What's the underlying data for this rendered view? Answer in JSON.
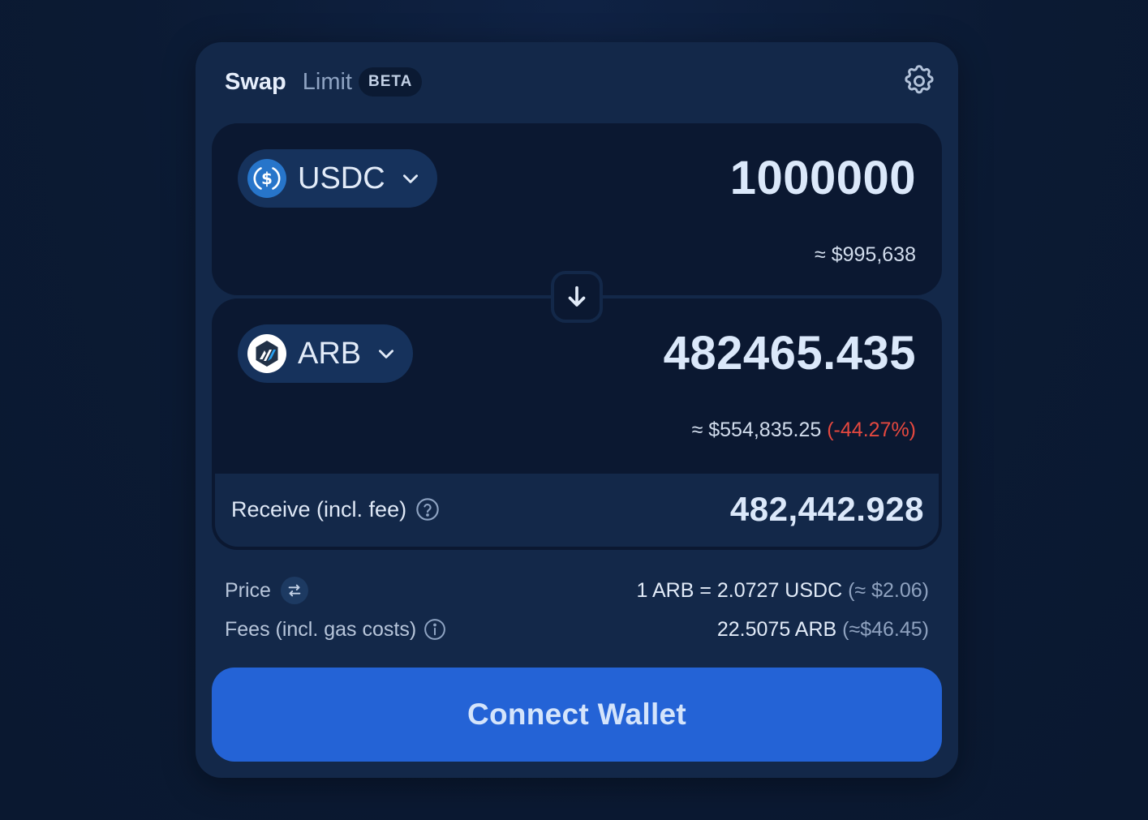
{
  "tabs": {
    "swap": "Swap",
    "limit": "Limit",
    "limit_badge": "BETA"
  },
  "icons": {
    "settings": "gear-icon",
    "flip": "arrow-down-icon",
    "help": "question-circle-icon",
    "price_swap": "swap-arrows-icon",
    "info": "info-circle-icon",
    "chevron": "chevron-down-icon"
  },
  "from": {
    "token": "USDC",
    "amount": "1000000",
    "usd_value": "≈ $995,638"
  },
  "to": {
    "token": "ARB",
    "amount": "482465.435",
    "usd_value": "≈ $554,835.25",
    "price_impact": "(-44.27%)"
  },
  "receive": {
    "label": "Receive (incl. fee)",
    "value": "482,442.928"
  },
  "price": {
    "label": "Price",
    "value": "1 ARB = 2.0727 USDC",
    "usd": "(≈ $2.06)"
  },
  "fees": {
    "label": "Fees (incl. gas costs)",
    "value": "22.5075 ARB",
    "usd": "(≈$46.45)"
  },
  "connect_label": "Connect Wallet",
  "colors": {
    "background": "#0b1a33",
    "card": "#132849",
    "panel": "#0b1831",
    "accent": "#2463d6",
    "negative": "#e5483f",
    "usdc_blue": "#2775ca"
  }
}
